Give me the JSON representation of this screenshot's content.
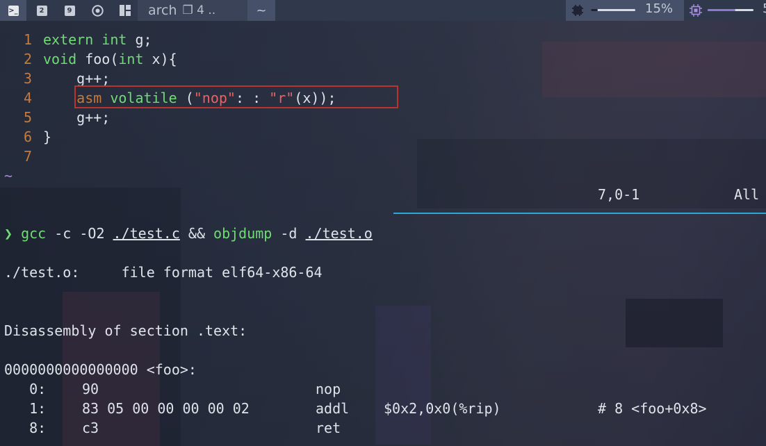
{
  "topbar": {
    "tags": [
      "2",
      "9"
    ],
    "window_title": "arch",
    "window_count": "❐ 4 ..",
    "tab_label": "~",
    "mem_percent": "15%",
    "mem_level": 0.15,
    "cpu_percent_truncated": "5",
    "colors": {
      "mem_bar": "#e6e9ef",
      "cpu_bar": "#8d7ad0"
    }
  },
  "editor": {
    "lines": [
      {
        "n": "1"
      },
      {
        "n": "2"
      },
      {
        "n": "3"
      },
      {
        "n": "4"
      },
      {
        "n": "5"
      },
      {
        "n": "6"
      },
      {
        "n": "7"
      }
    ],
    "code": {
      "l1_kw1": "extern",
      "l1_kw2": "int",
      "l1_rest": " g;",
      "l2_kw1": "void",
      "l2_mid": " foo(",
      "l2_kw2": "int",
      "l2_rest": " x){",
      "l3": "    g++;",
      "l4_asm": "asm",
      "l4_kw": "volatile",
      "l4_a": " (",
      "l4_s1": "\"nop\"",
      "l4_b": ": : ",
      "l4_s2": "\"r\"",
      "l4_c": "(x));",
      "l5": "    g++;",
      "l6": "}",
      "tilde": "~"
    },
    "ruler_pos": "7,0-1",
    "ruler_all": "All"
  },
  "shell": {
    "prompt_symbol": "❯",
    "cmd1": "gcc",
    "args1": " -c -O2 ",
    "path1": "./test.c",
    "amp": " && ",
    "cmd2": "objdump",
    "args2": " -d ",
    "path2": "./test.o",
    "out_format": "./test.o:     file format elf64-x86-64",
    "out_section": "Disassembly of section .text:",
    "out_symbol": "0000000000000000 <foo>:",
    "disasm": [
      {
        "addr": "   0:",
        "bytes": "90",
        "mnemonic": "nop",
        "operands": "",
        "comment": ""
      },
      {
        "addr": "   1:",
        "bytes": "83 05 00 00 00 00 02",
        "mnemonic": "addl",
        "operands": "$0x2,0x0(%rip)",
        "comment": "# 8 <foo+0x8>"
      },
      {
        "addr": "   8:",
        "bytes": "c3",
        "mnemonic": "ret",
        "operands": "",
        "comment": ""
      }
    ]
  }
}
